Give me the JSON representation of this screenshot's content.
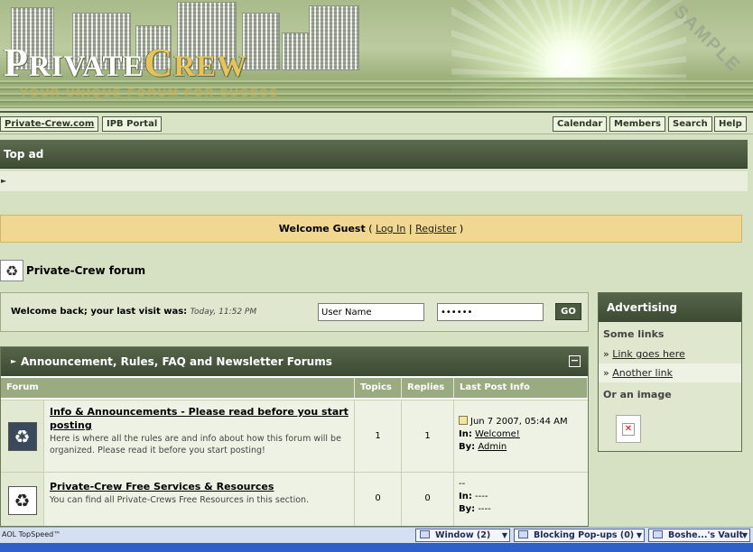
{
  "banner": {
    "logo_first_letter": "P",
    "logo_rest": "RIVATE",
    "logo_second_letter": "C",
    "logo_second_rest": "REW",
    "tagline": "YOUR UNIQUE FORUM FOR SUCESS",
    "watermark": "SAMPLE"
  },
  "nav": {
    "site_link": "Private-Crew.com",
    "portal": "IPB Portal",
    "calendar": "Calendar",
    "members": "Members",
    "search": "Search",
    "help": "Help"
  },
  "top_ad": {
    "title": "Top ad"
  },
  "welcome": {
    "prefix": "Welcome Guest",
    "open_paren": "(",
    "login": "Log In",
    "separator": "|",
    "register": "Register",
    "close_paren": ")"
  },
  "forum": {
    "title": "Private-Crew forum"
  },
  "login_strip": {
    "message": "Welcome back; your last visit was:",
    "last_visit": "Today, 11:52 PM",
    "username_value": "User Name",
    "password_value": "••••••",
    "go_label": "GO"
  },
  "category": {
    "title": "Announcement, Rules, FAQ and Newsletter Forums",
    "collapse_symbol": "−",
    "columns": [
      "Forum",
      "Topics",
      "Replies",
      "Last Post Info"
    ],
    "rows": [
      {
        "name": "Info & Announcements - Please read before you start posting",
        "description": "Here is where all the rules are and info about how this forum will be organized. Please read it before you start posting!",
        "topics": "1",
        "replies": "1",
        "last_post_date": "Jun 7 2007, 05:44 AM",
        "in_label": "In:",
        "in_value": "Welcome!",
        "by_label": "By:",
        "by_value": "Admin",
        "has_new": true
      },
      {
        "name": "Private-Crew Free Services & Resources",
        "description": "You can find all Private-Crews Free Resources in this section.",
        "topics": "0",
        "replies": "0",
        "last_post_date": "--",
        "in_label": "In:",
        "in_value": "----",
        "by_label": "By:",
        "by_value": "----",
        "has_new": false
      }
    ]
  },
  "advertising": {
    "title": "Advertising",
    "links_heading": "Some links",
    "links": [
      "Link goes here",
      "Another link"
    ],
    "image_heading": "Or an image"
  },
  "taskbar": {
    "aol": "AOL TopSpeed™",
    "window": "Window (2)",
    "popups": "Blocking Pop-ups (0)",
    "vault": "Boshe...'s Vault"
  },
  "colors": {
    "header_dark": "#3d4a33",
    "column_header": "#9aab82",
    "welcome_bar": "#f1d892",
    "page_bg": "#d6e0c2"
  }
}
